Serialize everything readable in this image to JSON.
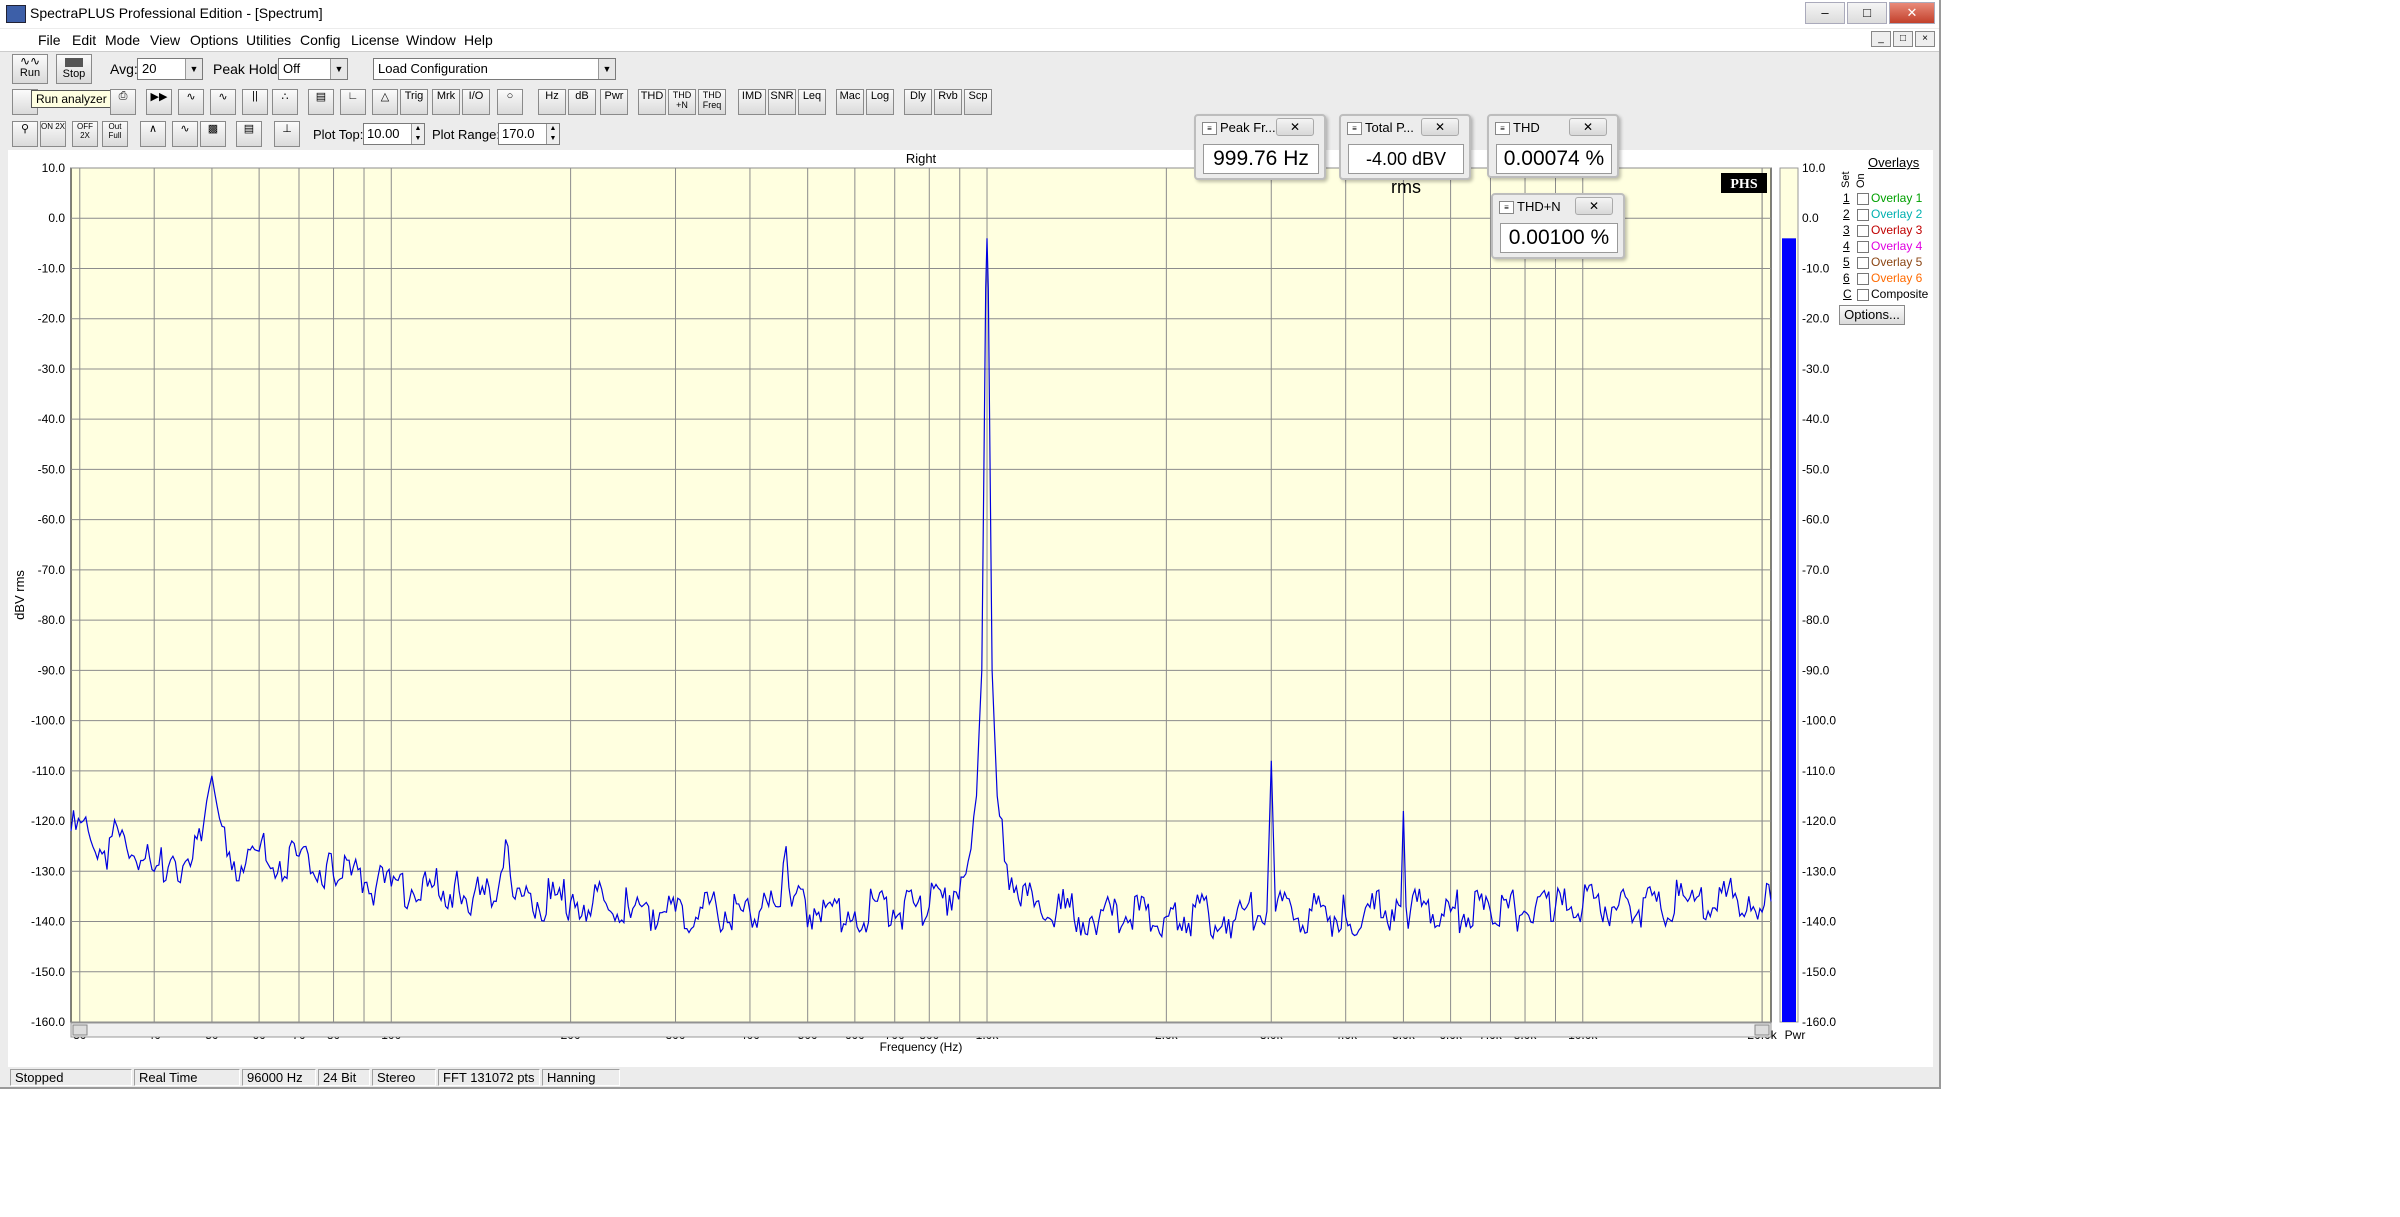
{
  "window": {
    "title": "SpectraPLUS Professional Edition - [Spectrum]"
  },
  "menu": [
    "File",
    "Edit",
    "Mode",
    "View",
    "Options",
    "Utilities",
    "Config",
    "License",
    "Window",
    "Help"
  ],
  "toolbar": {
    "run_label": "Run",
    "stop_label": "Stop",
    "avg_label": "Avg:",
    "avg_value": "20",
    "peakhold_label": "Peak Hold:",
    "peakhold_value": "Off",
    "config_value": "Load Configuration",
    "tooltip": "Run analyzer",
    "buttons": [
      "Trig",
      "Mrk",
      "I/O",
      "Hz",
      "dB",
      "Pwr",
      "THD",
      "THD +N",
      "THD Freq",
      "IMD",
      "SNR",
      "Leq",
      "Mac",
      "Log",
      "Dly",
      "Rvb",
      "Scp"
    ],
    "zoom_buttons": [
      "ON 2X",
      "OFF 2X",
      "Out Full"
    ],
    "plot_top_label": "Plot Top:",
    "plot_top_value": "10.00",
    "plot_range_label": "Plot Range:",
    "plot_range_value": "170.0"
  },
  "meters": [
    {
      "title": "Peak Fr...",
      "value": "999.76 Hz"
    },
    {
      "title": "Total P...",
      "value": "-4.00 dBV rms"
    },
    {
      "title": "THD",
      "value": "0.00074 %"
    },
    {
      "title": "THD+N",
      "value": "0.00100 %"
    }
  ],
  "overlays": {
    "title": "Overlays",
    "col_set": "Set",
    "col_on": "On",
    "items": [
      {
        "num": "1",
        "name": "Overlay 1",
        "color": "#00a000"
      },
      {
        "num": "2",
        "name": "Overlay 2",
        "color": "#00b0b0"
      },
      {
        "num": "3",
        "name": "Overlay 3",
        "color": "#c00000"
      },
      {
        "num": "4",
        "name": "Overlay 4",
        "color": "#e000e0"
      },
      {
        "num": "5",
        "name": "Overlay 5",
        "color": "#8b4513"
      },
      {
        "num": "6",
        "name": "Overlay 6",
        "color": "#ff6a00"
      },
      {
        "num": "C",
        "name": "Composite",
        "color": "#000000"
      }
    ],
    "options_label": "Options..."
  },
  "status": [
    "Stopped",
    "Real Time",
    "96000 Hz",
    "24 Bit",
    "Stereo",
    "FFT 131072 pts",
    "Hanning"
  ],
  "chart_data": {
    "type": "line",
    "title": "Right",
    "xlabel": "Frequency (Hz)",
    "ylabel": "dBV rms",
    "x_scale": "log",
    "xlim": [
      29,
      20700
    ],
    "ylim": [
      -160,
      10
    ],
    "grid": true,
    "logo": "PHS",
    "x_ticks": [
      {
        "v": 30,
        "label": "30"
      },
      {
        "v": 40,
        "label": "40"
      },
      {
        "v": 50,
        "label": "50"
      },
      {
        "v": 60,
        "label": "60"
      },
      {
        "v": 70,
        "label": "70"
      },
      {
        "v": 80,
        "label": "80"
      },
      {
        "v": 100,
        "label": "100"
      },
      {
        "v": 200,
        "label": "200"
      },
      {
        "v": 300,
        "label": "300"
      },
      {
        "v": 400,
        "label": "400"
      },
      {
        "v": 500,
        "label": "500"
      },
      {
        "v": 600,
        "label": "600"
      },
      {
        "v": 700,
        "label": "700"
      },
      {
        "v": 800,
        "label": "800"
      },
      {
        "v": 1000,
        "label": "1.0k"
      },
      {
        "v": 2000,
        "label": "2.0k"
      },
      {
        "v": 3000,
        "label": "3.0k"
      },
      {
        "v": 4000,
        "label": "4.0k"
      },
      {
        "v": 5000,
        "label": "5.0k"
      },
      {
        "v": 6000,
        "label": "6.0k"
      },
      {
        "v": 7000,
        "label": "7.0k"
      },
      {
        "v": 8000,
        "label": "8.0k"
      },
      {
        "v": 10000,
        "label": "10.0k"
      },
      {
        "v": 20000,
        "label": "20.0k"
      }
    ],
    "y_ticks": [
      10,
      0,
      -10,
      -20,
      -30,
      -40,
      -50,
      -60,
      -70,
      -80,
      -90,
      -100,
      -110,
      -120,
      -130,
      -140,
      -150,
      -160
    ],
    "y_tick_labels": [
      "10.0",
      "0.0",
      "-10.0",
      "-20.0",
      "-30.0",
      "-40.0",
      "-50.0",
      "-60.0",
      "-70.0",
      "-80.0",
      "-90.0",
      "-100.0",
      "-110.0",
      "-120.0",
      "-130.0",
      "-140.0",
      "-150.0",
      "-160.0"
    ],
    "series": [
      {
        "color": "#0000e0",
        "points": [
          [
            29,
            -122
          ],
          [
            31,
            -122
          ],
          [
            33,
            -126
          ],
          [
            35,
            -123
          ],
          [
            37,
            -127
          ],
          [
            40,
            -130
          ],
          [
            43,
            -127
          ],
          [
            46,
            -129
          ],
          [
            48,
            -124
          ],
          [
            49,
            -116
          ],
          [
            50,
            -111
          ],
          [
            51,
            -117
          ],
          [
            53,
            -127
          ],
          [
            56,
            -129
          ],
          [
            60,
            -126
          ],
          [
            65,
            -128
          ],
          [
            70,
            -127
          ],
          [
            80,
            -131
          ],
          [
            100,
            -133
          ],
          [
            130,
            -134
          ],
          [
            150,
            -136
          ],
          [
            157,
            -125
          ],
          [
            160,
            -135
          ],
          [
            200,
            -136
          ],
          [
            250,
            -137
          ],
          [
            300,
            -138
          ],
          [
            400,
            -138
          ],
          [
            450,
            -137
          ],
          [
            460,
            -125
          ],
          [
            470,
            -137
          ],
          [
            600,
            -138
          ],
          [
            800,
            -137
          ],
          [
            880,
            -134
          ],
          [
            930,
            -128
          ],
          [
            960,
            -115
          ],
          [
            980,
            -90
          ],
          [
            990,
            -40
          ],
          [
            995,
            -14
          ],
          [
            1000,
            -4
          ],
          [
            1005,
            -14
          ],
          [
            1010,
            -40
          ],
          [
            1020,
            -90
          ],
          [
            1040,
            -115
          ],
          [
            1070,
            -128
          ],
          [
            1120,
            -133
          ],
          [
            1200,
            -137
          ],
          [
            1500,
            -139
          ],
          [
            2000,
            -139
          ],
          [
            2500,
            -139
          ],
          [
            2950,
            -138
          ],
          [
            3000,
            -108
          ],
          [
            3050,
            -138
          ],
          [
            4000,
            -139
          ],
          [
            4950,
            -137
          ],
          [
            5000,
            -118
          ],
          [
            5050,
            -137
          ],
          [
            6000,
            -138
          ],
          [
            7000,
            -138
          ],
          [
            9000,
            -137
          ],
          [
            12000,
            -137
          ],
          [
            15000,
            -136
          ],
          [
            19000,
            -135
          ],
          [
            20700,
            -136
          ]
        ]
      }
    ],
    "level_bar": {
      "label": "Pwr",
      "value": -4,
      "ylim": [
        -160,
        10
      ],
      "color": "#0000ff"
    }
  }
}
